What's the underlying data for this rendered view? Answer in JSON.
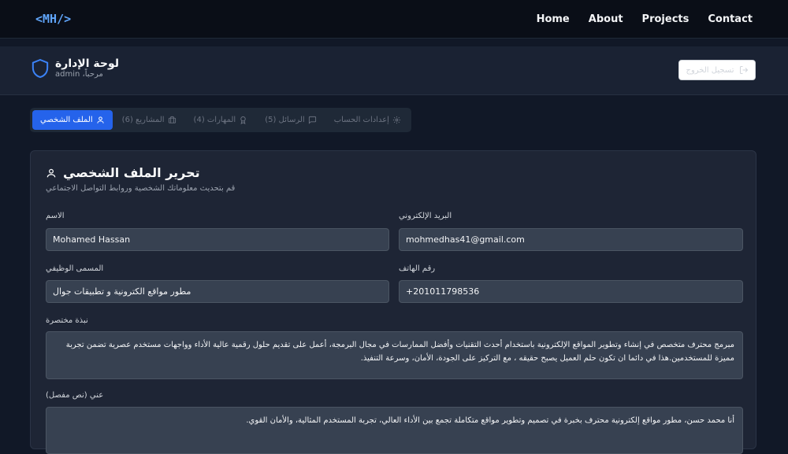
{
  "nav": {
    "logo": "<MH/>",
    "links": [
      "Home",
      "About",
      "Projects",
      "Contact"
    ]
  },
  "header": {
    "title": "لوحة الإدارة",
    "subtitle": "مرحباً، admin",
    "logout_label": "تسجيل الخروج"
  },
  "tabs": [
    {
      "label": "الملف الشخصي",
      "icon": "user-icon",
      "active": true
    },
    {
      "label": "المشاريع (6)",
      "icon": "briefcase-icon",
      "active": false
    },
    {
      "label": "المهارات (4)",
      "icon": "award-icon",
      "active": false
    },
    {
      "label": "الرسائل (5)",
      "icon": "message-icon",
      "active": false
    },
    {
      "label": "إعدادات الحساب",
      "icon": "gear-icon",
      "active": false
    }
  ],
  "profile": {
    "title": "تحرير الملف الشخصي",
    "subtitle": "قم بتحديث معلوماتك الشخصية وروابط التواصل الاجتماعي",
    "name_label": "الاسم",
    "name_value": "Mohamed Hassan",
    "email_label": "البريد الإلكتروني",
    "email_value": "mohmedhas41@gmail.com",
    "job_label": "المسمى الوظيفي",
    "job_value": "مطور مواقع الكترونية و تطبيقات جوال",
    "phone_label": "رقم الهاتف",
    "phone_value": "+201011798536",
    "bio_label": "نبذة مختصرة",
    "bio_value": "مبرمج محترف متخصص في إنشاء وتطوير المواقع الإلكترونية باستخدام أحدث التقنيات وأفضل الممارسات في مجال البرمجة، أعمل على تقديم حلول رقمية عالية الأداء وواجهات مستخدم عصرية تضمن تجربة مميزة للمستخدمين.هذا في دائما ان تكون حلم العميل يصبح حقيقه ، مع التركيز على الجودة، الأمان، وسرعة التنفيذ.",
    "about_label": "عني (نص مفصل)",
    "about_value": "أنا محمد حسن، مطور مواقع إلكترونية محترف بخبرة في تصميم وتطوير مواقع متكاملة تجمع بين الأداء العالي، تجربة المستخدم المثالية، والأمان القوي."
  },
  "colors": {
    "accent": "#2563eb",
    "logo": "#60a5fa"
  }
}
